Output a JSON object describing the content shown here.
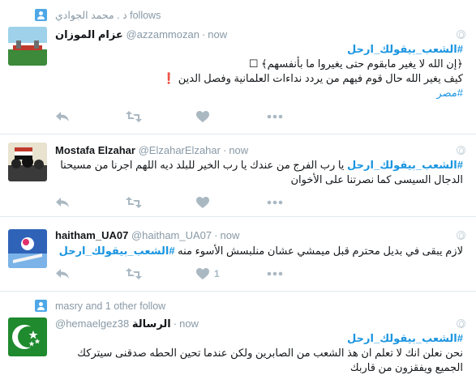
{
  "tweets": [
    {
      "context": "د . محمد الجوادي follows",
      "name": "عزام الموزان",
      "handle": "@azzammozan",
      "time": "now",
      "lines": [
        "#الشعب_بيقولك_ارحل",
        "﴿إن الله لا يغير مابقوم حتى يغيروا ما بأنفسهم﴾ ☐",
        "كيف يغير الله حال قوم فيهم من يردد نداءات العلمانية وفصل الدين",
        "#مصر"
      ],
      "exclamation": "❗"
    },
    {
      "name": "Mostafa Elzahar",
      "handle": "@ElzaharElzahar",
      "time": "now",
      "hashtag": "#الشعب_بيقولك_ارحل",
      "text": " يا رب الفرج من عندك يا رب الخير للبلد ديه  اللهم اجرنا من مسيحنا الدجال السيسى كما نصرتنا على الأخوان"
    },
    {
      "name": "haitham_UA07",
      "handle": "@haitham_UA07",
      "time": "now",
      "text": "لازم يبقى في بديل محترم قبل ميمشي عشان منلبسش الأسوء منه ",
      "hashtag": "#الشعب_بيقولك_ارحل",
      "like_count": "1"
    },
    {
      "context": "masry and 1 other follow",
      "name": "الرسالة",
      "handle": "@hemaelgez38",
      "time": "now",
      "hashtag": "#الشعب_بيقولك_ارحل",
      "text": "نحن نعلن انك لا تعلم ان هذ الشعب من الصابرين ولكن عندما تحين الحطه صدقنى سيتركك الجميع ويفقزون من قاربك"
    }
  ],
  "separator": "·",
  "colors": {
    "link": "#1b95e0",
    "meta": "#8899a6",
    "action": "#aab8c2",
    "follow_icon": "#4ea8e8"
  },
  "icons": [
    "person-icon",
    "globe-icon",
    "reply-icon",
    "retweet-icon",
    "like-icon",
    "more-icon"
  ]
}
